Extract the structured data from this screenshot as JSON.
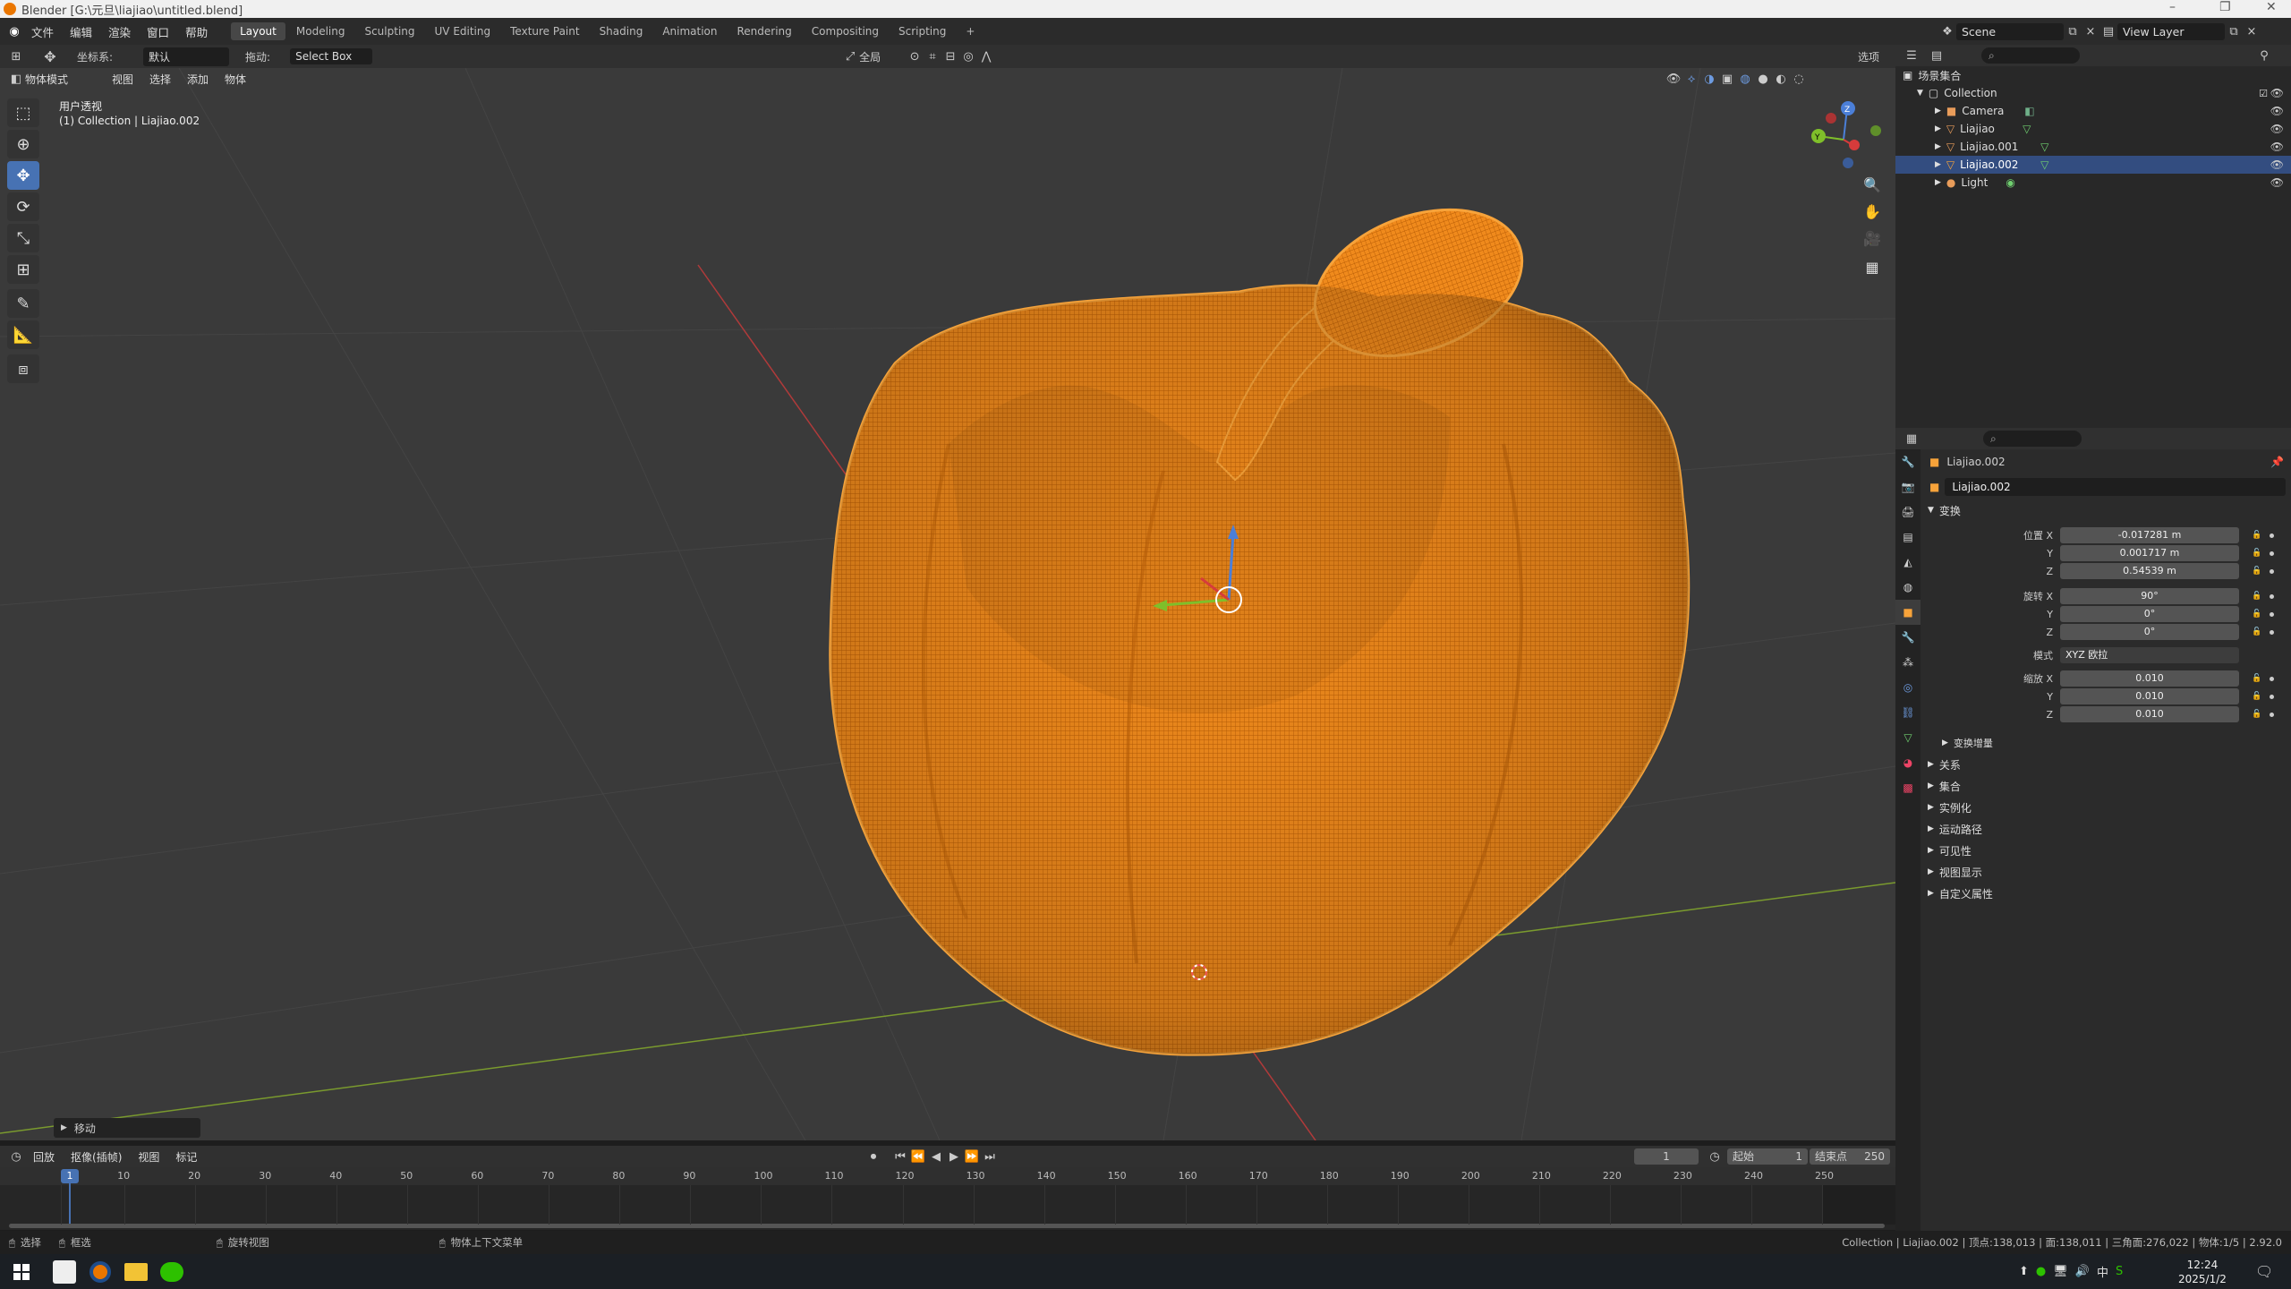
{
  "window": {
    "title": "Blender [G:\\元旦\\liajiao\\untitled.blend]",
    "minimize": "–",
    "maximize": "❐",
    "close": "✕"
  },
  "menu": [
    "文件",
    "编辑",
    "渲染",
    "窗口",
    "帮助"
  ],
  "workspaces": [
    "Layout",
    "Modeling",
    "Sculpting",
    "UV Editing",
    "Texture Paint",
    "Shading",
    "Animation",
    "Rendering",
    "Compositing",
    "Scripting"
  ],
  "workspace_add": "+",
  "active_workspace": "Layout",
  "scene": {
    "name": "Scene",
    "view_layer": "View Layer"
  },
  "tool_header": {
    "orientation_label": "坐标系:",
    "orientation_value": "默认",
    "drag_label": "拖动:",
    "drag_value": "Select Box",
    "pivot_value": "全局",
    "options_label": "选项"
  },
  "viewport_header": {
    "mode": "物体模式",
    "menus": [
      "视图",
      "选择",
      "添加",
      "物体"
    ]
  },
  "viewport_info": {
    "view_name": "用户透视",
    "collection_path": "(1) Collection | Liajiao.002"
  },
  "gizmo_axes": {
    "x": "X",
    "y": "Y",
    "z": "Z"
  },
  "last_operator": "移动",
  "outliner": {
    "root": "场景集合",
    "items": [
      {
        "name": "Collection",
        "level": 1,
        "type": "collection",
        "selected": false
      },
      {
        "name": "Camera",
        "level": 2,
        "type": "camera",
        "selected": false
      },
      {
        "name": "Liajiao",
        "level": 2,
        "type": "mesh",
        "selected": false
      },
      {
        "name": "Liajiao.001",
        "level": 2,
        "type": "mesh",
        "selected": false
      },
      {
        "name": "Liajiao.002",
        "level": 2,
        "type": "mesh",
        "selected": true
      },
      {
        "name": "Light",
        "level": 2,
        "type": "light",
        "selected": false
      }
    ]
  },
  "properties": {
    "object_name": "Liajiao.002",
    "object_field": "Liajiao.002",
    "transform_title": "变换",
    "location": {
      "label_x": "位置 X",
      "label_y": "Y",
      "label_z": "Z",
      "x": "-0.017281 m",
      "y": "0.001717 m",
      "z": "0.54539 m"
    },
    "rotation": {
      "label_x": "旋转 X",
      "label_y": "Y",
      "label_z": "Z",
      "x": "90°",
      "y": "0°",
      "z": "0°"
    },
    "mode": {
      "label": "模式",
      "value": "XYZ 欧拉"
    },
    "scale": {
      "label_x": "缩放 X",
      "label_y": "Y",
      "label_z": "Z",
      "x": "0.010",
      "y": "0.010",
      "z": "0.010"
    },
    "delta_transform": "变换增量",
    "sections": [
      "关系",
      "集合",
      "实例化",
      "运动路径",
      "可见性",
      "视图显示",
      "自定义属性"
    ]
  },
  "timeline": {
    "menus": [
      "回放",
      "抠像(插帧)",
      "视图",
      "标记"
    ],
    "current_frame": "1",
    "start_label": "起始",
    "start": "1",
    "end_label": "结束点",
    "end": "250",
    "ticks": [
      "1",
      "10",
      "20",
      "30",
      "40",
      "50",
      "60",
      "70",
      "80",
      "90",
      "100",
      "110",
      "120",
      "130",
      "140",
      "150",
      "160",
      "170",
      "180",
      "190",
      "200",
      "210",
      "220",
      "230",
      "240",
      "250"
    ]
  },
  "statusbar": {
    "select": "选择",
    "box_select": "框选",
    "rotate_view": "旋转视图",
    "context_menu": "物体上下文菜单",
    "stats": "Collection | Liajiao.002 | 顶点:138,013 | 面:138,011 | 三角面:276,022 | 物体:1/5 | 2.92.0"
  },
  "taskbar": {
    "time": "12:24",
    "date": "2025/1/2",
    "ime": "中"
  },
  "colors": {
    "accent": "#4772b3",
    "selection_orange": "#f7941d",
    "outliner_selected": "#334d80",
    "viewport_bg": "#3a3a3a"
  }
}
